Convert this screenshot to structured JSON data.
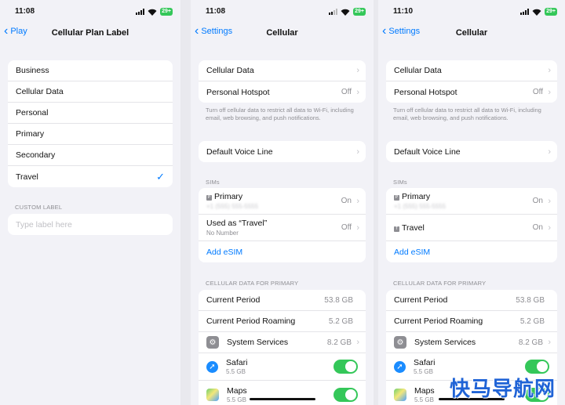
{
  "screen1": {
    "time": "11:08",
    "battery": "29+",
    "back_label": "Play",
    "title": "Cellular Plan Label",
    "labels": [
      "Business",
      "Cellular Data",
      "Personal",
      "Primary",
      "Secondary",
      "Travel"
    ],
    "selected": "Travel",
    "custom_label_header": "CUSTOM LABEL",
    "custom_label_placeholder": "Type label here"
  },
  "screen2": {
    "time": "11:08",
    "battery": "29+",
    "back_label": "Settings",
    "title": "Cellular",
    "cellular_data": "Cellular Data",
    "hotspot": "Personal Hotspot",
    "hotspot_value": "Off",
    "footnote": "Turn off cellular data to restrict all data to Wi-Fi, including email, web browsing, and push notifications.",
    "voice_line": "Default Voice Line",
    "sims_header": "SIMs",
    "primary_label": "Primary",
    "primary_value": "On",
    "used_as": "Used as “Travel”",
    "no_number": "No Number",
    "used_value": "Off",
    "add_esim": "Add eSIM",
    "usage_header": "CELLULAR DATA FOR PRIMARY",
    "current_period": "Current Period",
    "current_period_value": "53.8 GB",
    "roaming": "Current Period Roaming",
    "roaming_value": "5.2 GB",
    "system_services": "System Services",
    "system_services_value": "8.2 GB",
    "safari": "Safari",
    "safari_size": "5.5 GB",
    "maps": "Maps",
    "maps_size": "5.5 GB"
  },
  "screen3": {
    "time": "11:10",
    "battery": "29+",
    "back_label": "Settings",
    "title": "Cellular",
    "cellular_data": "Cellular Data",
    "hotspot": "Personal Hotspot",
    "hotspot_value": "Off",
    "footnote": "Turn off cellular data to restrict all data to Wi-Fi, including email, web browsing, and push notifications.",
    "voice_line": "Default Voice Line",
    "sims_header": "SIMs",
    "primary_label": "Primary",
    "primary_value": "On",
    "travel_label": "Travel",
    "travel_value": "On",
    "add_esim": "Add eSIM",
    "usage_header": "CELLULAR DATA FOR PRIMARY",
    "current_period": "Current Period",
    "current_period_value": "53.8 GB",
    "roaming": "Current Period Roaming",
    "roaming_value": "5.2 GB",
    "system_services": "System Services",
    "system_services_value": "8.2 GB",
    "safari": "Safari",
    "safari_size": "5.5 GB",
    "maps": "Maps",
    "maps_size": "5.5 GB"
  },
  "watermark": "快马导航网",
  "colors": {
    "accent": "#007aff",
    "toggle_on": "#34c759",
    "background": "#f2f2f7"
  }
}
